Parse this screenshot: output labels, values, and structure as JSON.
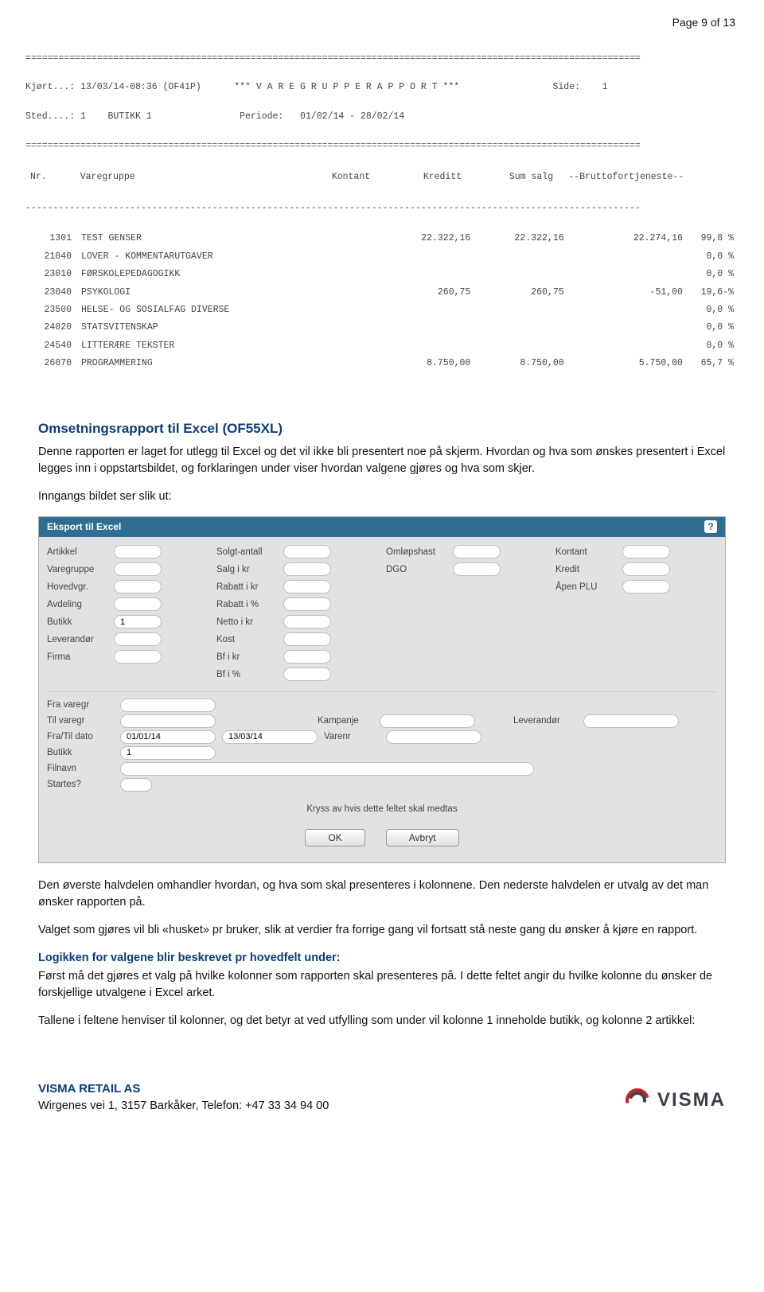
{
  "page_label": "Page 9 of 13",
  "report": {
    "run_line": "Kjørt...: 13/03/14-08:36 (OF41P)      *** V A R E G R U P P E R A P P O R T ***                 Side:    1",
    "sted_line": "Sted....: 1    BUTIKK 1                Periode:   01/02/14 - 28/02/14",
    "headers": [
      "Nr.",
      "Varegruppe",
      "Kontant",
      "Kreditt",
      "Sum salg",
      "--Bruttofortjeneste--",
      ""
    ],
    "rows": [
      {
        "nr": "1301",
        "name": "TEST GENSER",
        "kontant": "",
        "kreditt": "22.322,16",
        "sum": "22.322,16",
        "bf": "22.274,16",
        "pct": "99,8 %"
      },
      {
        "nr": "21040",
        "name": "LOVER - KOMMENTARUTGAVER",
        "kontant": "",
        "kreditt": "",
        "sum": "",
        "bf": "",
        "pct": "0,0 %"
      },
      {
        "nr": "23010",
        "name": "FØRSKOLEPEDAGOGIKK",
        "kontant": "",
        "kreditt": "",
        "sum": "",
        "bf": "",
        "pct": "0,0 %"
      },
      {
        "nr": "23040",
        "name": "PSYKOLOGI",
        "kontant": "",
        "kreditt": "260,75",
        "sum": "260,75",
        "bf": "-51,00",
        "pct": "19,6-%"
      },
      {
        "nr": "23500",
        "name": "HELSE- OG SOSIALFAG DIVERSE",
        "kontant": "",
        "kreditt": "",
        "sum": "",
        "bf": "",
        "pct": "0,0 %"
      },
      {
        "nr": "24020",
        "name": "STATSVITENSKAP",
        "kontant": "",
        "kreditt": "",
        "sum": "",
        "bf": "",
        "pct": "0,0 %"
      },
      {
        "nr": "24540",
        "name": "LITTERÆRE TEKSTER",
        "kontant": "",
        "kreditt": "",
        "sum": "",
        "bf": "",
        "pct": "0,0 %"
      },
      {
        "nr": "26070",
        "name": "PROGRAMMERING",
        "kontant": "",
        "kreditt": "8.750,00",
        "sum": "8.750,00",
        "bf": "5.750,00",
        "pct": "65,7 %"
      }
    ]
  },
  "heading": "Omsetningsrapport til Excel (OF55XL)",
  "para1": "Denne rapporten er laget for utlegg til Excel og det vil ikke bli presentert noe på skjerm. Hvordan og hva som ønskes presentert i Excel legges inn i oppstartsbildet, og forklaringen under viser hvordan valgene gjøres og hva som skjer.",
  "para2": "Inngangs bildet ser slik ut:",
  "panel": {
    "title": "Eksport til Excel",
    "top": {
      "col1": [
        {
          "label": "Artikkel",
          "value": ""
        },
        {
          "label": "Varegruppe",
          "value": ""
        },
        {
          "label": "Hovedvgr.",
          "value": ""
        },
        {
          "label": "Avdeling",
          "value": ""
        },
        {
          "label": "Butikk",
          "value": "1"
        },
        {
          "label": "Leverandør",
          "value": ""
        },
        {
          "label": "Firma",
          "value": ""
        }
      ],
      "col2": [
        {
          "label": "Solgt-antall",
          "value": ""
        },
        {
          "label": "Salg i kr",
          "value": ""
        },
        {
          "label": "Rabatt i kr",
          "value": ""
        },
        {
          "label": "Rabatt i %",
          "value": ""
        },
        {
          "label": "Netto i kr",
          "value": ""
        },
        {
          "label": "Kost",
          "value": ""
        },
        {
          "label": "Bf i kr",
          "value": ""
        },
        {
          "label": "Bf i %",
          "value": ""
        }
      ],
      "col3": [
        {
          "label": "Omløpshast",
          "value": ""
        },
        {
          "label": "DGO",
          "value": ""
        }
      ],
      "col4": [
        {
          "label": "Kontant",
          "value": ""
        },
        {
          "label": "Kredit",
          "value": ""
        },
        {
          "label": "Åpen PLU",
          "value": ""
        }
      ]
    },
    "lower": {
      "fra_varegr_label": "Fra varegr",
      "til_varegr_label": "Til varegr",
      "kampanje_label": "Kampanje",
      "leverandor_label": "Leverandør",
      "fratil_label": "Fra/Til dato",
      "fra_dato": "01/01/14",
      "til_dato": "13/03/14",
      "varenr_label": "Varenr",
      "butikk_label": "Butikk",
      "butikk_value": "1",
      "filnavn_label": "Filnavn",
      "startes_label": "Startes?"
    },
    "note": "Kryss av hvis dette feltet skal medtas",
    "ok": "OK",
    "cancel": "Avbryt"
  },
  "para3": "Den øverste halvdelen omhandler hvordan, og hva som skal presenteres i kolonnene. Den nederste halvdelen er utvalg av det man ønsker rapporten på.",
  "para4": "Valget som gjøres vil bli «husket» pr bruker, slik at verdier fra forrige gang vil fortsatt stå neste gang du ønsker å kjøre en rapport.",
  "sub_heading": "Logikken for valgene blir beskrevet pr hovedfelt under:",
  "para5": "Først må det gjøres et valg på hvilke kolonner som rapporten skal presenteres på. I dette feltet angir du hvilke kolonne du ønsker de forskjellige utvalgene i Excel arket.",
  "para6": "Tallene i feltene henviser til kolonner, og det betyr at ved utfylling som under vil kolonne 1 inneholde butikk, og kolonne 2 artikkel:",
  "footer": {
    "company": "VISMA RETAIL AS",
    "address": "Wirgenes vei 1, 3157 Barkåker, Telefon: +47 33 34 94 00",
    "logo": "VISMA"
  }
}
